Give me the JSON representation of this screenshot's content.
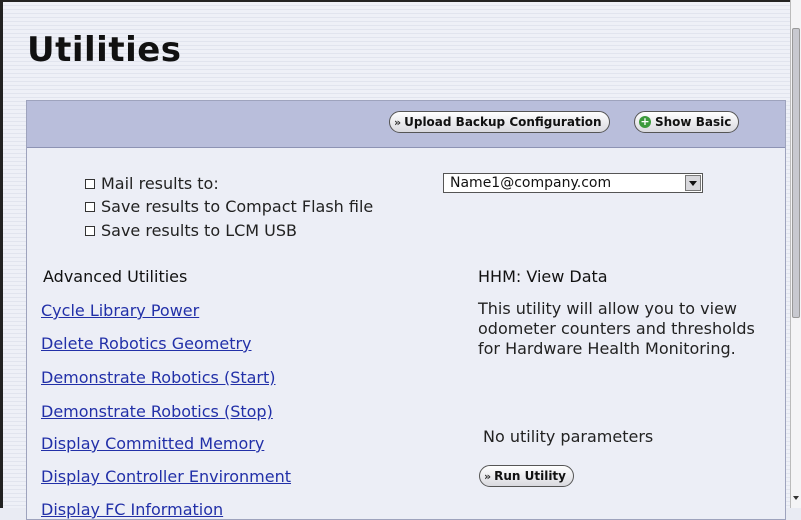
{
  "page": {
    "title": "Utilities"
  },
  "header": {
    "upload_label": "Upload Backup Configuration",
    "show_basic_label": "Show Basic"
  },
  "options": {
    "mail_label": "Mail results to:",
    "compact_flash_label": "Save results to Compact Flash file",
    "lcm_usb_label": "Save results to LCM USB",
    "email_selected": "Name1@company.com"
  },
  "advanced": {
    "heading": "Advanced Utilities",
    "links": [
      "Cycle Library Power",
      "Delete Robotics Geometry",
      "Demonstrate Robotics (Start)",
      "Demonstrate Robotics (Stop)",
      "Display Committed Memory",
      "Display Controller Environment",
      "Display FC Information"
    ]
  },
  "detail": {
    "heading": "HHM: View Data",
    "description": "This utility will allow you to view odometer counters and thresholds for Hardware Health Monitoring.",
    "no_params": "No utility parameters",
    "run_label": "Run Utility"
  },
  "icons": {
    "arrow": "double-chevron-right-icon",
    "plus": "plus-circle-icon",
    "checkbox": "checkbox-icon",
    "dropdown": "chevron-down-icon"
  },
  "colors": {
    "header_bg": "#b9bedb",
    "link": "#2230a8",
    "plus_icon": "#3c9a3c"
  }
}
